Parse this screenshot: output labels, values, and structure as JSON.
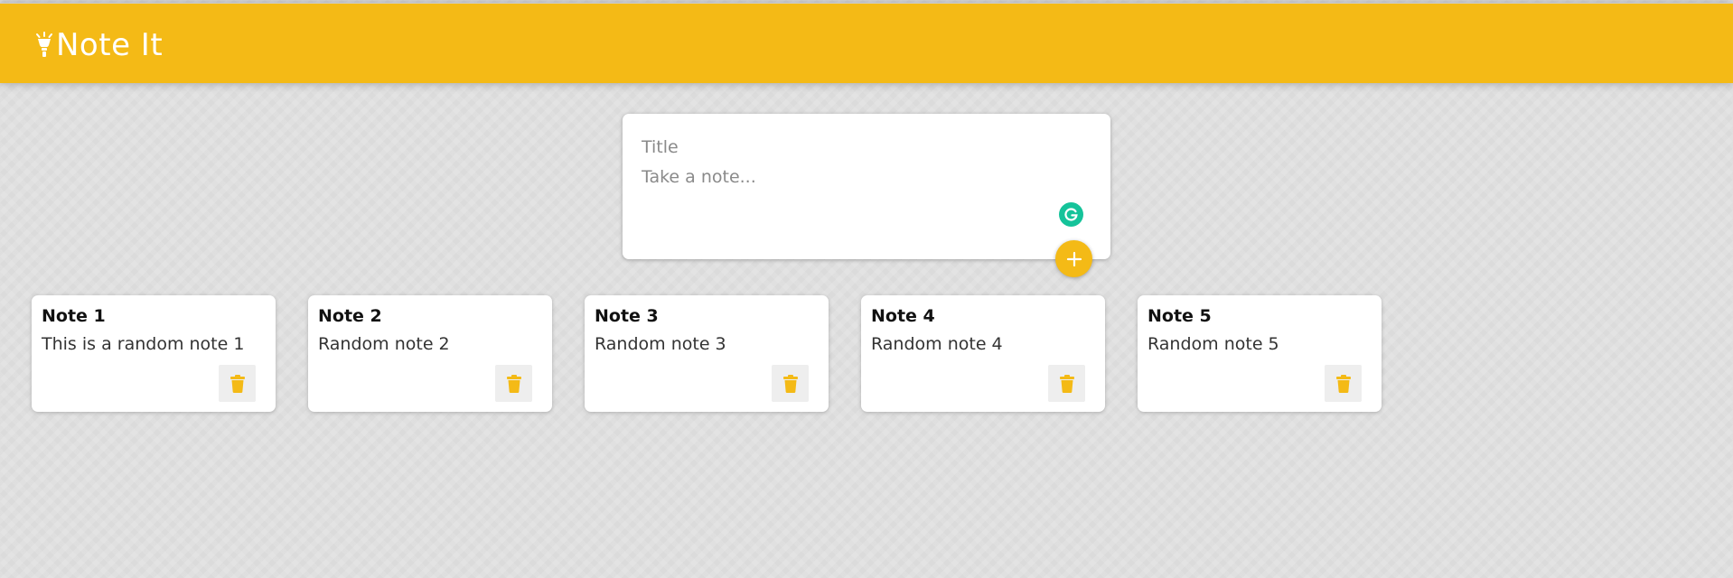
{
  "header": {
    "title": "Note It",
    "brand_color": "#f4ba16",
    "logo_icon": "lightbulb-icon"
  },
  "create_form": {
    "title_placeholder": "Take a note...",
    "title_field_placeholder": "Title",
    "content_placeholder": "Take a note...",
    "add_icon": "plus-icon",
    "grammarly_icon": "grammarly-icon",
    "grammarly_color": "#15c39a"
  },
  "notes": [
    {
      "title": "Note 1",
      "content": "This is a random note 1"
    },
    {
      "title": "Note 2",
      "content": "Random note 2"
    },
    {
      "title": "Note 3",
      "content": "Random note 3"
    },
    {
      "title": "Note 4",
      "content": "Random note 4"
    },
    {
      "title": "Note 5",
      "content": "Random note 5"
    }
  ],
  "note_delete_icon": "trash-icon",
  "background_color": "#e0e0e0"
}
